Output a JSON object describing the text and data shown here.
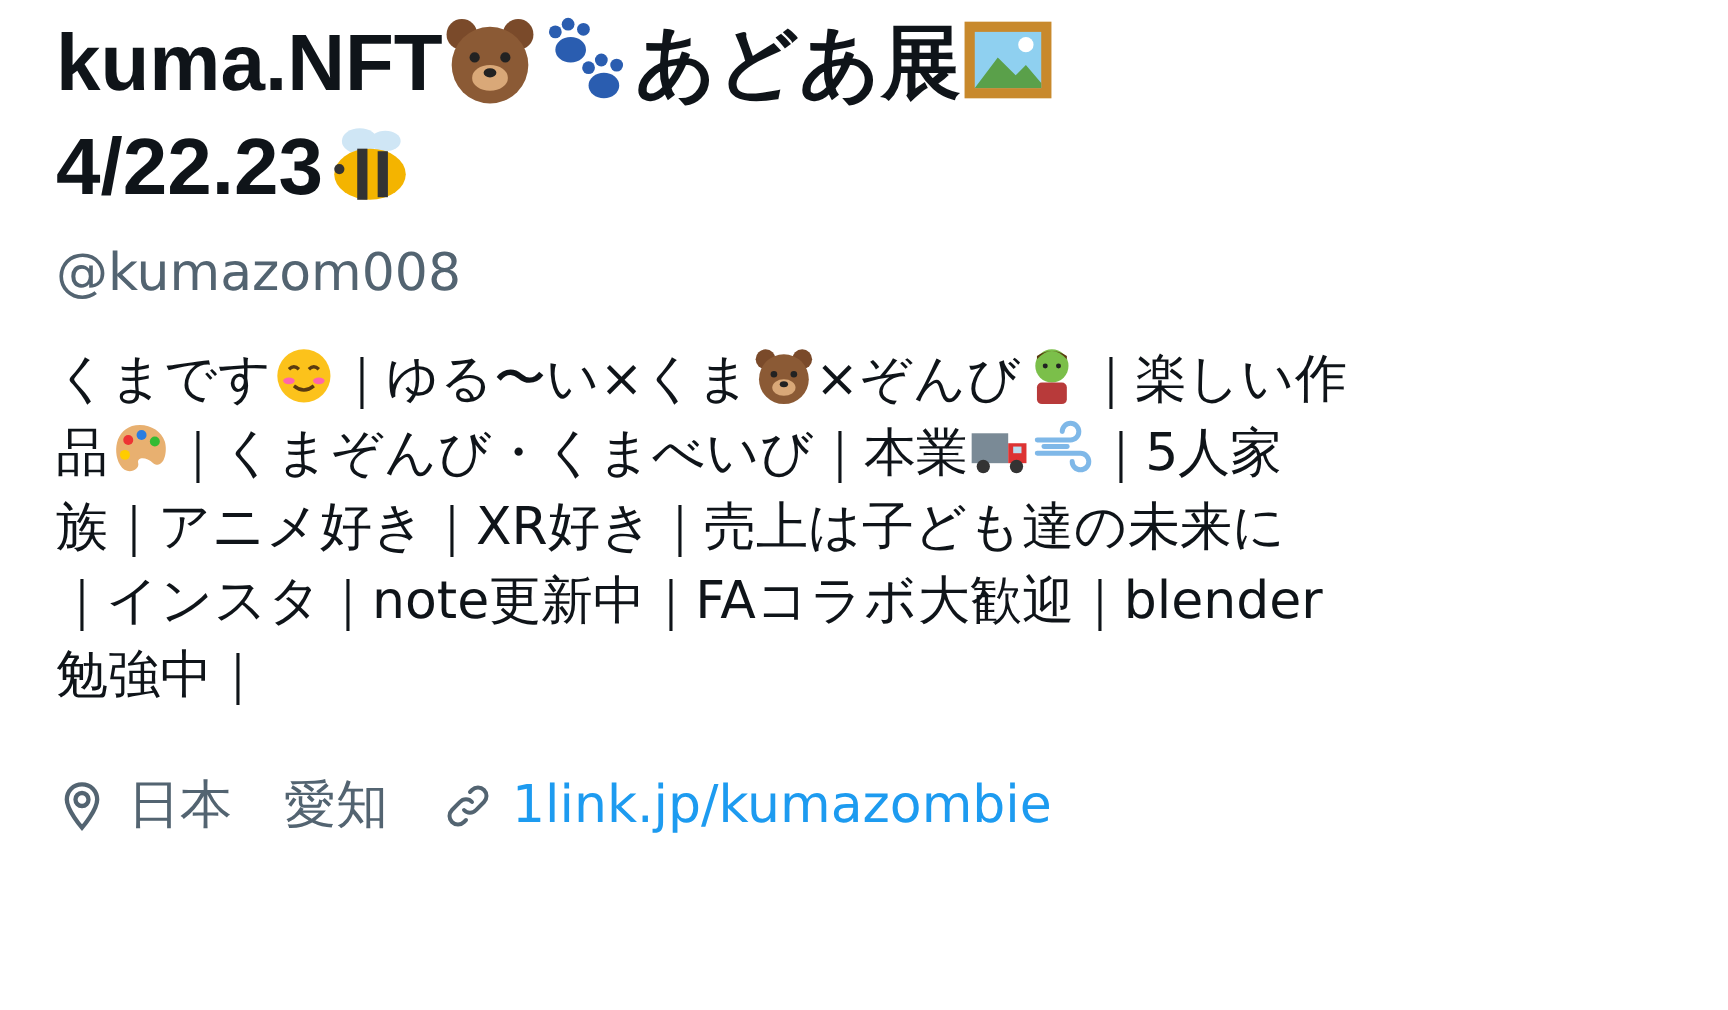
{
  "profile": {
    "name_lines": [
      [
        {
          "kind": "text",
          "text": "kuma.NFT"
        },
        {
          "kind": "emoji"
        },
        {
          "kind": "emoji"
        },
        {
          "kind": "text",
          "text": "あどあ展"
        },
        {
          "kind": "emoji"
        }
      ],
      [
        {
          "kind": "text",
          "text": "4/22.23"
        },
        {
          "kind": "emoji"
        }
      ]
    ],
    "handle": "@kumazom008",
    "bio_lines": [
      [
        {
          "kind": "text",
          "text": "くまです"
        },
        {
          "kind": "emoji"
        },
        {
          "kind": "text",
          "text": "｜ゆる〜い×くま"
        },
        {
          "kind": "emoji"
        },
        {
          "kind": "text",
          "text": "×ぞんび"
        },
        {
          "kind": "emoji"
        },
        {
          "kind": "text",
          "text": "｜楽しい作"
        }
      ],
      [
        {
          "kind": "text",
          "text": "品"
        },
        {
          "kind": "emoji"
        },
        {
          "kind": "text",
          "text": "｜くまぞんび・くまべいび｜本業"
        },
        {
          "kind": "emoji"
        },
        {
          "kind": "emoji"
        },
        {
          "kind": "text",
          "text": "｜5人家"
        }
      ],
      [
        {
          "kind": "text",
          "text": "族｜アニメ好き｜XR好き｜売上は子ども達の未来に"
        }
      ],
      [
        {
          "kind": "text",
          "text": "｜インスタ｜note更新中｜FAコラボ大歓迎｜blender"
        }
      ],
      [
        {
          "kind": "text",
          "text": "勉強中｜"
        }
      ]
    ],
    "location": "日本　愛知",
    "link": "1link.jp/kumazombie"
  }
}
